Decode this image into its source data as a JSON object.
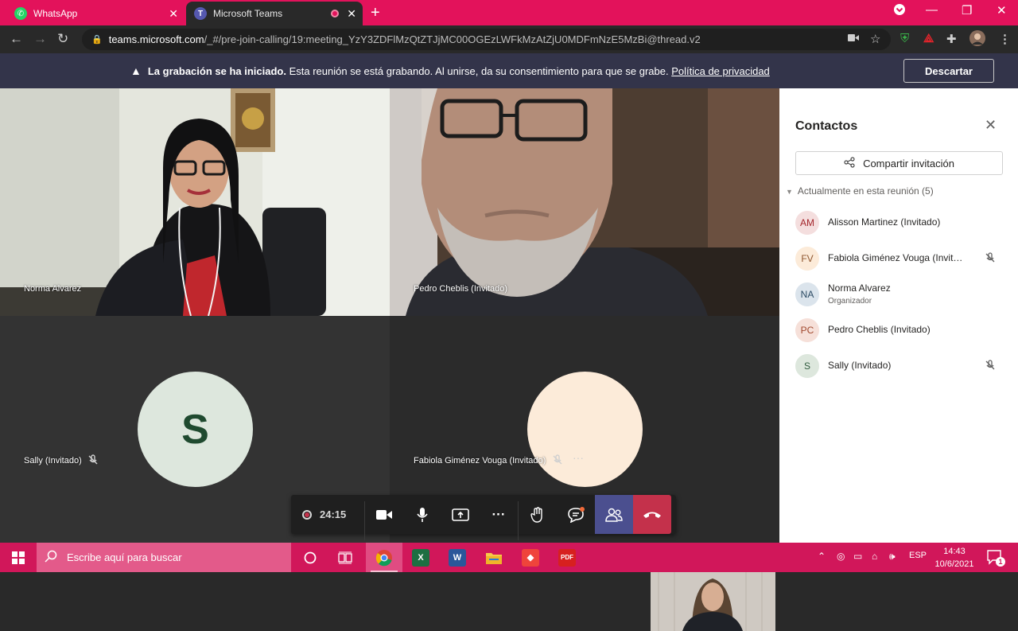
{
  "browser": {
    "tabs": [
      {
        "label": "WhatsApp"
      },
      {
        "label": "Microsoft Teams"
      }
    ],
    "url_host": "teams.microsoft.com",
    "url_path": "/_#/pre-join-calling/19:meeting_YzY3ZDFlMzQtZTJjMC00OGEzLWFkMzAtZjU0MDFmNzE5MzBi@thread.v2"
  },
  "banner": {
    "bold": "La grabación se ha iniciado.",
    "text": "Esta reunión se está grabando. Al unirse, da su consentimiento para que se grabe.",
    "link": "Política de privacidad",
    "dismiss": "Descartar"
  },
  "tiles": [
    {
      "name": "Norma Alvarez"
    },
    {
      "name": "Pedro Cheblis (Invitado)"
    },
    {
      "name": "Sally (Invitado)",
      "initial": "S"
    },
    {
      "name": "Fabiola Giménez Vouga (Invitado)"
    }
  ],
  "callbar": {
    "timer": "24:15"
  },
  "panel": {
    "title": "Contactos",
    "share": "Compartir invitación",
    "section": "Actualmente en esta reunión (5)",
    "participants": [
      {
        "initials": "AM",
        "name": "Alisson Martinez (Invitado)",
        "muted": false
      },
      {
        "initials": "FV",
        "name": "Fabiola Giménez Vouga (Invitado)",
        "muted": true
      },
      {
        "initials": "NA",
        "name": "Norma Alvarez",
        "role": "Organizador",
        "muted": false
      },
      {
        "initials": "PC",
        "name": "Pedro Cheblis (Invitado)",
        "muted": false
      },
      {
        "initials": "S",
        "name": "Sally (Invitado)",
        "muted": true
      }
    ]
  },
  "taskbar": {
    "search_placeholder": "Escribe aquí para buscar",
    "lang": "ESP",
    "time": "14:43",
    "date": "10/6/2021",
    "notifications": "1"
  },
  "colors": {
    "browser_accent": "#e3125b",
    "taskbar": "#d1175a",
    "banner": "#33344a",
    "teams_active": "#4b4f8f",
    "hangup": "#c4314b"
  }
}
